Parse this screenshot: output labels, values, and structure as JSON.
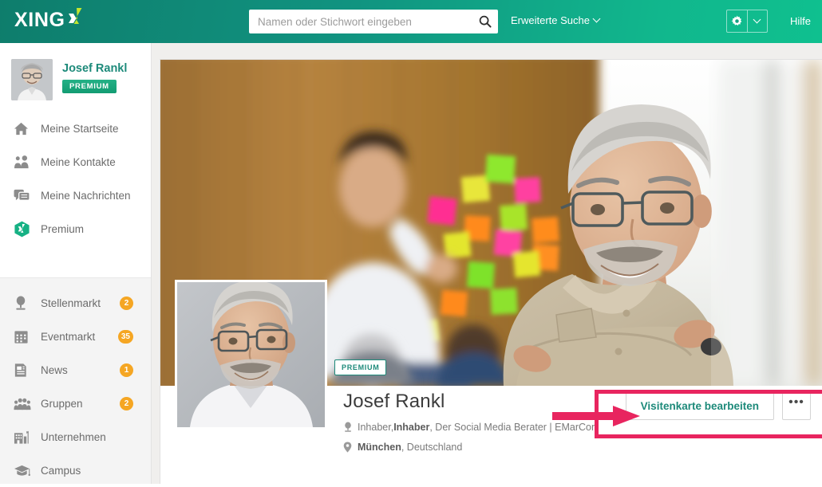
{
  "header": {
    "logo_text": "XING",
    "logo_icon": "xing-x-icon",
    "search": {
      "placeholder": "Namen oder Stichwort eingeben",
      "value": "",
      "icon": "search-icon"
    },
    "advanced_search_label": "Erweiterte Suche",
    "advanced_search_icon": "chevron-down-icon",
    "settings_icon": "gear-icon",
    "settings_caret_icon": "chevron-down-icon",
    "help_label": "Hilfe",
    "accent_color": "#0e8774",
    "accent_color_right": "#0fc08f"
  },
  "sidebar": {
    "user": {
      "name": "Josef Rankl",
      "badge": "PREMIUM",
      "avatar_icon": "user-avatar"
    },
    "items_top": [
      {
        "label": "Meine Startseite",
        "icon": "home-icon",
        "badge": ""
      },
      {
        "label": "Meine Kontakte",
        "icon": "contacts-icon",
        "badge": ""
      },
      {
        "label": "Meine Nachrichten",
        "icon": "messages-icon",
        "badge": ""
      },
      {
        "label": "Premium",
        "icon": "xing-premium-icon",
        "badge": ""
      }
    ],
    "items_bottom": [
      {
        "label": "Stellenmarkt",
        "icon": "job-icon",
        "badge": "2"
      },
      {
        "label": "Eventmarkt",
        "icon": "calendar-icon",
        "badge": "35"
      },
      {
        "label": "News",
        "icon": "news-icon",
        "badge": "1"
      },
      {
        "label": "Gruppen",
        "icon": "groups-icon",
        "badge": "2"
      },
      {
        "label": "Unternehmen",
        "icon": "company-icon",
        "badge": ""
      },
      {
        "label": "Campus",
        "icon": "graduation-cap-icon",
        "badge": ""
      }
    ],
    "badge_color": "#f5a623"
  },
  "profile": {
    "cover_premium_badge": "PREMIUM",
    "name": "Josef Rankl",
    "job": {
      "icon": "job-icon",
      "prefix": "Inhaber, ",
      "bold": "Inhaber",
      "suffix": ", Der Social Media Berater | EMarCon"
    },
    "location": {
      "icon": "location-pin-icon",
      "bold": "München",
      "suffix": ", Deutschland"
    },
    "edit_button_label": "Visitenkarte bearbeiten",
    "more_button_label": "•••",
    "link_color": "#1d8a7a"
  },
  "annotation": {
    "color": "#e8255f",
    "shape": "highlight-rectangle-with-arrow"
  }
}
